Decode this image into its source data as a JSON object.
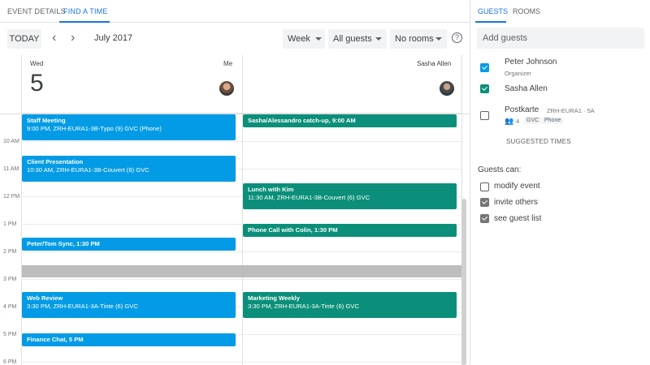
{
  "tabs": {
    "event_details": "EVENT DETAILS",
    "find_a_time": "FIND A TIME"
  },
  "toolbar": {
    "today": "TODAY",
    "prev": "‹",
    "next": "›",
    "month": "July 2017",
    "view": "Week",
    "guests_filter": "All guests",
    "rooms_filter": "No rooms",
    "help": "?"
  },
  "columns": [
    {
      "dow": "Wed",
      "day": "5",
      "person": "Me"
    },
    {
      "person": "Sasha Allen"
    }
  ],
  "hours": [
    "10 AM",
    "11 AM",
    "12 PM",
    "1 PM",
    "2 PM",
    "3 PM",
    "4 PM",
    "5 PM",
    "6 PM"
  ],
  "events_me": [
    {
      "title": "Staff Meeting",
      "detail": "9:00 PM, ZRH-EURA1-3B-Typo (9) GVC (Phone)"
    },
    {
      "title": "Client Presentation",
      "detail": "10:30 AM, ZRH-EURA1-3B-Couvert (6) GVC"
    },
    {
      "title": "Peter/Tom Sync, 1:30 PM",
      "detail": ""
    },
    {
      "title": "Web Review",
      "detail": "3:30 PM, ZRH-EURA1-3A-Tinte (6) GVC"
    },
    {
      "title": "Finance Chat, 5 PM",
      "detail": ""
    }
  ],
  "events_sasha": [
    {
      "title": "Sasha/Alessandro catch-up, 9:00 AM",
      "detail": ""
    },
    {
      "title": "Lunch with Kim",
      "detail": "11:30 AM, ZRH-EURA1-3B-Couvert (6) GVC"
    },
    {
      "title": "Phone Call with Colin, 1:30 PM",
      "detail": ""
    },
    {
      "title": "Marketing Weekly",
      "detail": "3:30 PM, ZRH-EURA1-3A-Tinte (6) GVC"
    }
  ],
  "right": {
    "tab_guests": "GUESTS",
    "tab_rooms": "ROOMS",
    "add_guests_placeholder": "Add guests",
    "guests": [
      {
        "name": "Peter Johnson",
        "sub": "Organizer",
        "checked": true,
        "color": "#039be5"
      },
      {
        "name": "Sasha Allen",
        "sub": "",
        "checked": true,
        "color": "#0b8f7a"
      },
      {
        "name": "Postkarte",
        "room": "ZRH-EURA1 · 5A",
        "capacity": "4",
        "chip1": "GVC",
        "chip2": "Phone",
        "checked": false
      }
    ],
    "suggested_times": "SUGGESTED TIMES",
    "guests_can": "Guests can:",
    "options": [
      {
        "label": "modify event",
        "checked": false
      },
      {
        "label": "invite others",
        "checked": true
      },
      {
        "label": "see guest list",
        "checked": true
      }
    ]
  },
  "colors": {
    "accent": "#1a73e8",
    "me_event": "#039be5",
    "sasha_event": "#0b8f7a",
    "blocked": "#bdbdbd"
  }
}
